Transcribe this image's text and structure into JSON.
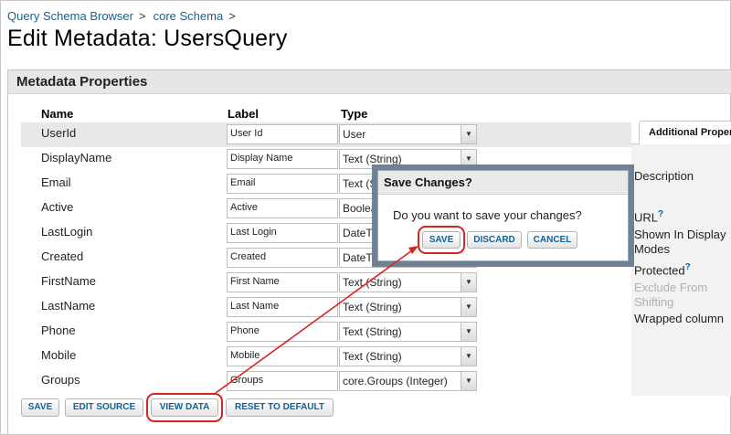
{
  "breadcrumb": {
    "items": [
      "Query Schema Browser",
      "core Schema"
    ],
    "separator": ">"
  },
  "page_title": "Edit Metadata: UsersQuery",
  "panel": {
    "title": "Metadata Properties"
  },
  "columns": {
    "name": "Name",
    "label": "Label",
    "type": "Type"
  },
  "fields": [
    {
      "name": "UserId",
      "label": "User Id",
      "type": "User"
    },
    {
      "name": "DisplayName",
      "label": "Display Name",
      "type": "Text (String)"
    },
    {
      "name": "Email",
      "label": "Email",
      "type": "Text (String)"
    },
    {
      "name": "Active",
      "label": "Active",
      "type": "Boolean"
    },
    {
      "name": "LastLogin",
      "label": "Last Login",
      "type": "DateTime"
    },
    {
      "name": "Created",
      "label": "Created",
      "type": "DateTime"
    },
    {
      "name": "FirstName",
      "label": "First Name",
      "type": "Text (String)"
    },
    {
      "name": "LastName",
      "label": "Last Name",
      "type": "Text (String)"
    },
    {
      "name": "Phone",
      "label": "Phone",
      "type": "Text (String)"
    },
    {
      "name": "Mobile",
      "label": "Mobile",
      "type": "Text (String)"
    },
    {
      "name": "Groups",
      "label": "Groups",
      "type": "core.Groups (Integer)"
    }
  ],
  "buttons": {
    "save": "SAVE",
    "edit_source": "EDIT SOURCE",
    "view_data": "VIEW DATA",
    "reset": "RESET TO DEFAULT"
  },
  "side_panel": {
    "tab": "Additional Properties",
    "description": "Description",
    "url": "URL",
    "shown_in_display": "Shown In Display",
    "modes": "Modes",
    "protected": "Protected",
    "exclude_from": "Exclude From",
    "shifting": "Shifting",
    "wrapped_column": "Wrapped column",
    "help_mark": "?"
  },
  "dialog": {
    "title": "Save Changes?",
    "message": "Do you want to save your changes?",
    "save": "SAVE",
    "discard": "DISCARD",
    "cancel": "CANCEL"
  },
  "colors": {
    "link": "#126495",
    "highlight": "#d8231f",
    "dialog_frame": "#6f8294"
  }
}
